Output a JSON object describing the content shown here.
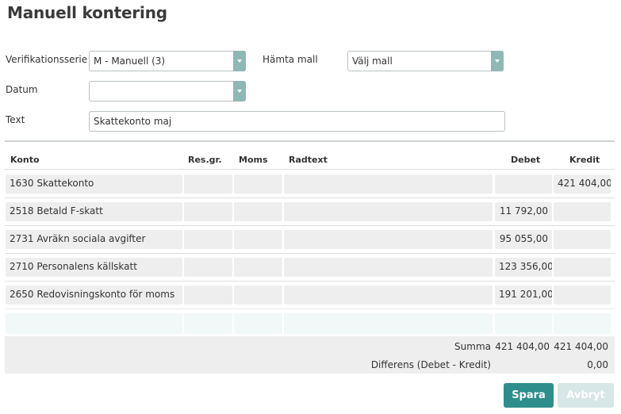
{
  "title": "Manuell kontering",
  "form": {
    "series_label": "Verifikationsserie",
    "series_value": "M - Manuell (3)",
    "template_label": "Hämta mall",
    "template_value": "Välj mall",
    "date_label": "Datum",
    "date_value": "",
    "text_label": "Text",
    "text_value": "Skattekonto maj"
  },
  "table": {
    "headers": {
      "konto": "Konto",
      "resgr": "Res.gr.",
      "moms": "Moms",
      "radtext": "Radtext",
      "debet": "Debet",
      "kredit": "Kredit"
    },
    "rows": [
      {
        "konto": "1630 Skattekonto",
        "resgr": "",
        "moms": "",
        "radtext": "",
        "debet": "",
        "kredit": "421 404,00"
      },
      {
        "konto": "2518 Betald F-skatt",
        "resgr": "",
        "moms": "",
        "radtext": "",
        "debet": "11 792,00",
        "kredit": ""
      },
      {
        "konto": "2731 Avräkn sociala avgifter",
        "resgr": "",
        "moms": "",
        "radtext": "",
        "debet": "95 055,00",
        "kredit": ""
      },
      {
        "konto": "2710 Personalens källskatt",
        "resgr": "",
        "moms": "",
        "radtext": "",
        "debet": "123 356,00",
        "kredit": ""
      },
      {
        "konto": "2650 Redovisningskonto för moms",
        "resgr": "",
        "moms": "",
        "radtext": "",
        "debet": "191 201,00",
        "kredit": ""
      }
    ]
  },
  "totals": {
    "summa_label": "Summa",
    "summa_debet": "421 404,00",
    "summa_kredit": "421 404,00",
    "diff_label": "Differens (Debet - Kredit)",
    "diff_value": "0,00"
  },
  "buttons": {
    "save": "Spara",
    "cancel": "Avbryt"
  },
  "colors": {
    "primary": "#2e8e8c",
    "dropdown_arrow": "#8fb8b5",
    "cancel_bg": "#d7e6e6",
    "cell_bg": "#eeeeee"
  }
}
